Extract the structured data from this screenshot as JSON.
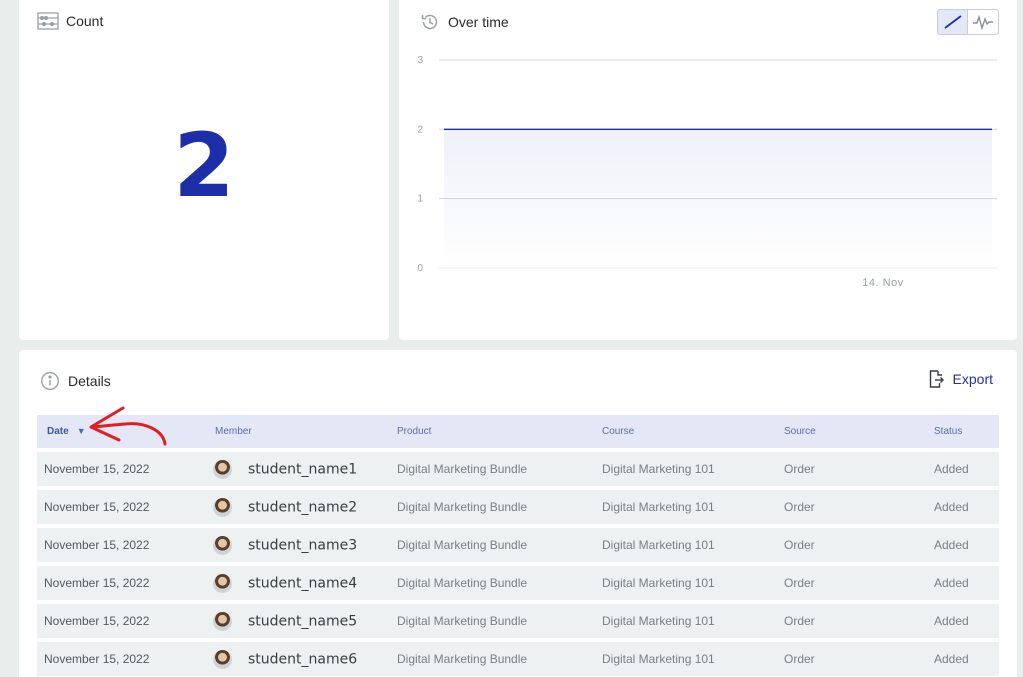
{
  "count_card": {
    "title": "Count",
    "value": "2",
    "icon": "abacus-icon"
  },
  "overtime_card": {
    "title": "Over time",
    "icon": "history-icon",
    "toggle": {
      "line_icon": "line-chart-icon",
      "pulse_icon": "pulse-chart-icon",
      "active": "line"
    }
  },
  "chart_data": {
    "type": "area",
    "x": [
      "14. Nov"
    ],
    "series": [
      {
        "values": [
          2
        ]
      }
    ],
    "yticks": [
      "0",
      "1",
      "2",
      "3"
    ],
    "xticks": [
      "14. Nov"
    ],
    "ylim": [
      0,
      3
    ],
    "color": "#1e2ea8"
  },
  "details": {
    "title": "Details",
    "icon": "info-icon",
    "export_label": "Export",
    "columns": [
      "Date",
      "Member",
      "Product",
      "Course",
      "Source",
      "Status"
    ],
    "sort_column": "Date",
    "rows": [
      {
        "date": "November 15, 2022",
        "member": "student_name1",
        "product": "Digital Marketing Bundle",
        "course": "Digital Marketing 101",
        "source": "Order",
        "status": "Added"
      },
      {
        "date": "November 15, 2022",
        "member": "student_name2",
        "product": "Digital Marketing Bundle",
        "course": "Digital Marketing 101",
        "source": "Order",
        "status": "Added"
      },
      {
        "date": "November 15, 2022",
        "member": "student_name3",
        "product": "Digital Marketing Bundle",
        "course": "Digital Marketing 101",
        "source": "Order",
        "status": "Added"
      },
      {
        "date": "November 15, 2022",
        "member": "student_name4",
        "product": "Digital Marketing Bundle",
        "course": "Digital Marketing 101",
        "source": "Order",
        "status": "Added"
      },
      {
        "date": "November 15, 2022",
        "member": "student_name5",
        "product": "Digital Marketing Bundle",
        "course": "Digital Marketing 101",
        "source": "Order",
        "status": "Added"
      },
      {
        "date": "November 15, 2022",
        "member": "student_name6",
        "product": "Digital Marketing Bundle",
        "course": "Digital Marketing 101",
        "source": "Order",
        "status": "Added"
      }
    ]
  },
  "colors": {
    "accent": "#1e2ea8",
    "header_bg": "#e3e7f6",
    "row_bg": "#eef1f1",
    "annotation": "#e02020"
  }
}
